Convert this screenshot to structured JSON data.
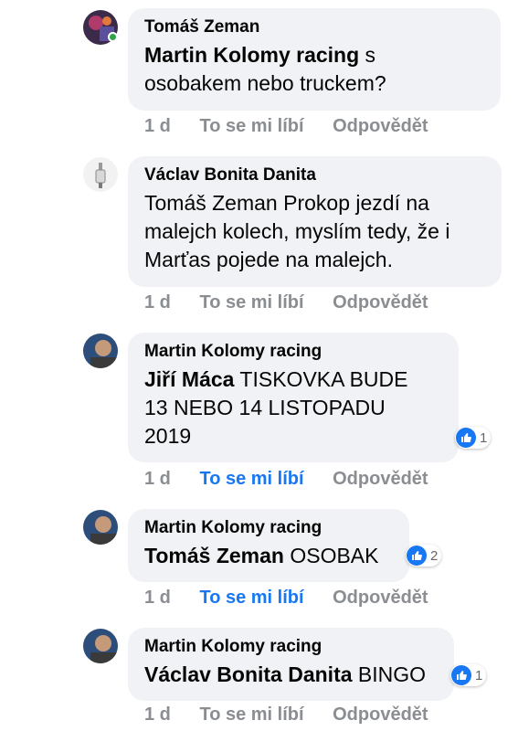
{
  "colors": {
    "link_blue": "#1877f2",
    "bubble_bg": "#f0f2f5",
    "meta_gray": "#8a8d91",
    "online_green": "#31a24c"
  },
  "actions": {
    "like": "To se mi líbí",
    "reply": "Odpovědět"
  },
  "comments": [
    {
      "author": "Tomáš Zeman",
      "mention": "Martin Kolomy racing",
      "text_line1": " s",
      "text_line2": "osobakem nebo truckem?",
      "time": "1 d",
      "liked": false,
      "online": true,
      "avatar_icon": "profile-photo"
    },
    {
      "author": "Václav Bonita Danita",
      "text_line1": "Tomáš Zeman Prokop jezdí na",
      "text_line2": "malejch kolech, myslím tedy, že i",
      "text_line3": "Marťas pojede na malejch.",
      "time": "1 d",
      "liked": false,
      "avatar_icon": "spark-plug-photo"
    },
    {
      "author": "Martin Kolomy racing",
      "mention": "Jiří Máca",
      "text_line1": " TISKOVKA BUDE",
      "text_line2": "13 NEBO 14 LISTOPADU",
      "text_line3": "2019",
      "time": "1 d",
      "liked": true,
      "reaction_count": "1",
      "avatar_icon": "profile-photo"
    },
    {
      "author": "Martin Kolomy racing",
      "mention": "Tomáš Zeman",
      "text_line1": " OSOBAK",
      "time": "1 d",
      "liked": true,
      "reaction_count": "2",
      "avatar_icon": "profile-photo"
    },
    {
      "author": "Martin Kolomy racing",
      "mention": "Václav Bonita Danita",
      "text_line1": " BINGO",
      "time": "1 d",
      "liked": false,
      "reaction_count": "1",
      "avatar_icon": "profile-photo"
    }
  ]
}
